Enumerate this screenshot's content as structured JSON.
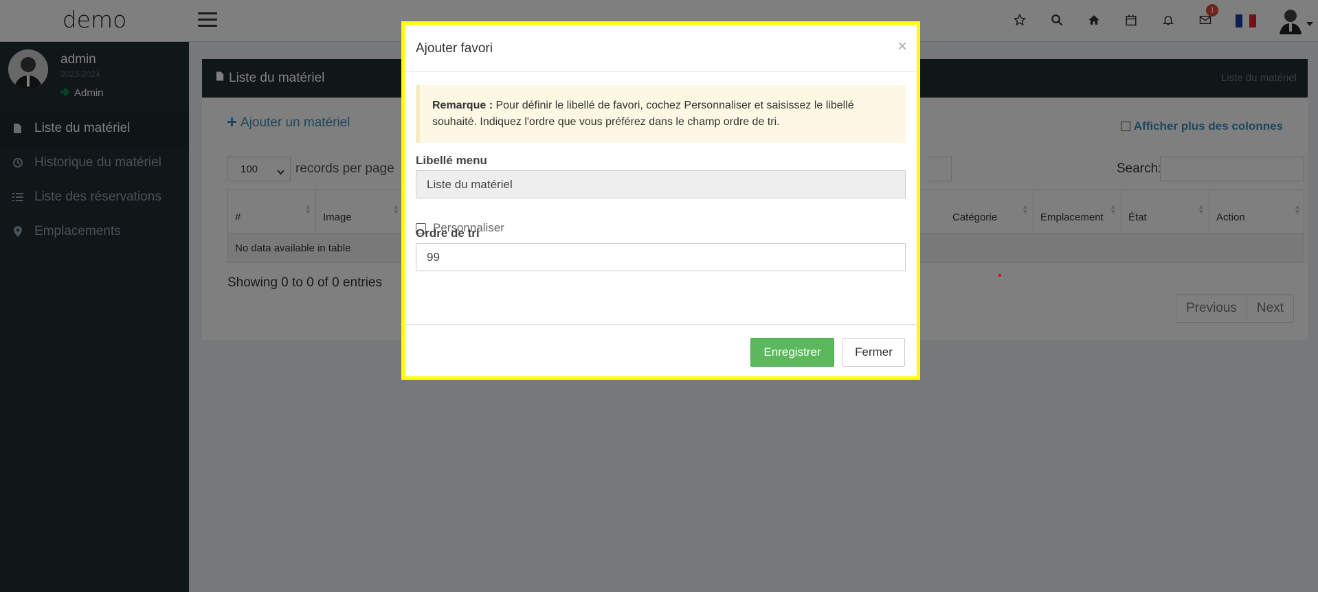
{
  "app": {
    "title": "demo"
  },
  "topbar": {
    "icons": [
      "star-icon",
      "search-icon",
      "home-icon",
      "calendar-icon",
      "bell-icon",
      "envelope-icon"
    ],
    "mail_badge": "1",
    "flag_colors": [
      "#1a3fa0",
      "#ffffff",
      "#e1232b"
    ]
  },
  "user": {
    "name": "admin",
    "year": "2023-2024",
    "role": "Admin"
  },
  "sidebar": {
    "items": [
      {
        "label": "Liste du matériel",
        "icon": "file-export-icon",
        "active": true
      },
      {
        "label": "Historique du matériel",
        "icon": "history-icon",
        "active": false
      },
      {
        "label": "Liste des réservations",
        "icon": "list-icon",
        "active": false
      },
      {
        "label": "Emplacements",
        "icon": "map-marker-icon",
        "active": false
      }
    ]
  },
  "page": {
    "title": "Liste du matériel",
    "breadcrumb": "Liste du matériel",
    "add_link": "Ajouter un matériel",
    "more_columns": "Afficher plus des colonnes",
    "length_value": "100",
    "length_label": "records per page",
    "search_label": "Search:",
    "columns": [
      "#",
      "Image",
      "Catégorie",
      "Emplacement",
      "État",
      "Action"
    ],
    "empty_text": "No data available in table",
    "showing": "Showing 0 to 0 of 0 entries",
    "prev": "Previous",
    "next": "Next"
  },
  "modal": {
    "title": "Ajouter favori",
    "close": "×",
    "note_label": "Remarque :",
    "note_text": " Pour définir le libellé de favori, cochez Personnaliser et saisissez le libellé souhaité. Indiquez l'ordre que vous préférez dans le champ ordre de tri.",
    "menu_label": "Libellé menu",
    "menu_value": "Liste du matériel",
    "customize_label": "Personnaliser",
    "order_label": "Ordre de tri",
    "order_value": "99",
    "save": "Enregistrer",
    "close_button": "Fermer"
  },
  "colors": {
    "accent": "#3c8dbc",
    "sidebar": "#222d32",
    "save": "#5cb85c",
    "highlight": "#ffff00"
  }
}
